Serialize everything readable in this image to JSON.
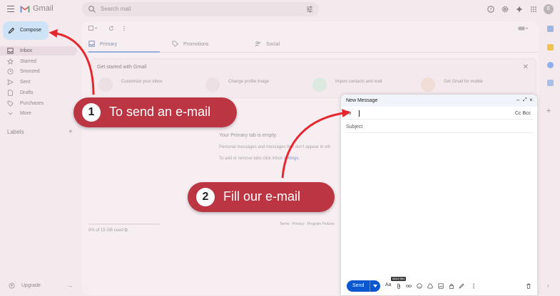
{
  "header": {
    "app_name": "Gmail",
    "search_placeholder": "Search mail",
    "avatar_letter": "E"
  },
  "sidebar": {
    "compose_label": "Compose",
    "items": [
      {
        "label": "Inbox",
        "icon": "inbox-icon",
        "active": true
      },
      {
        "label": "Starred",
        "icon": "star-icon"
      },
      {
        "label": "Snoozed",
        "icon": "clock-icon"
      },
      {
        "label": "Sent",
        "icon": "send-icon"
      },
      {
        "label": "Drafts",
        "icon": "draft-icon"
      },
      {
        "label": "Purchases",
        "icon": "tag-icon"
      },
      {
        "label": "More",
        "icon": "chevron-down-icon"
      }
    ],
    "labels_heading": "Labels",
    "labels_add": "+",
    "upgrade_label": "Upgrade"
  },
  "tabs": [
    {
      "label": "Primary",
      "active": true
    },
    {
      "label": "Promotions"
    },
    {
      "label": "Social"
    }
  ],
  "get_started": {
    "title": "Get started with Gmail",
    "cards": [
      {
        "text": "Customize your inbox"
      },
      {
        "text": "Change profile image"
      },
      {
        "text": "Import contacts and mail"
      },
      {
        "text": "Get Gmail for mobile"
      }
    ]
  },
  "empty_state": {
    "line1": "Your Primary tab is empty.",
    "line2": "Personal messages and messages that don't appear in oth",
    "line3_prefix": "To add or remove tabs click inbox",
    "line3_link": "settings."
  },
  "storage": "0% of 15 GB used",
  "footer": "Terms · Privacy · Program Policies",
  "compose_window": {
    "title": "New Message",
    "to_label": "To",
    "cc_bcc": "Cc Bcc",
    "subject_placeholder": "Subject",
    "send_label": "Send",
    "format_label": "Aa",
    "tooltip": "Attach files"
  },
  "callouts": [
    {
      "number": "1",
      "text": "To send an e-mail"
    },
    {
      "number": "2",
      "text": "Fill our e-mail"
    }
  ],
  "colors": {
    "callout": "#bb3543",
    "send_button": "#0b57d0",
    "compose_button": "#cfe3f6"
  }
}
